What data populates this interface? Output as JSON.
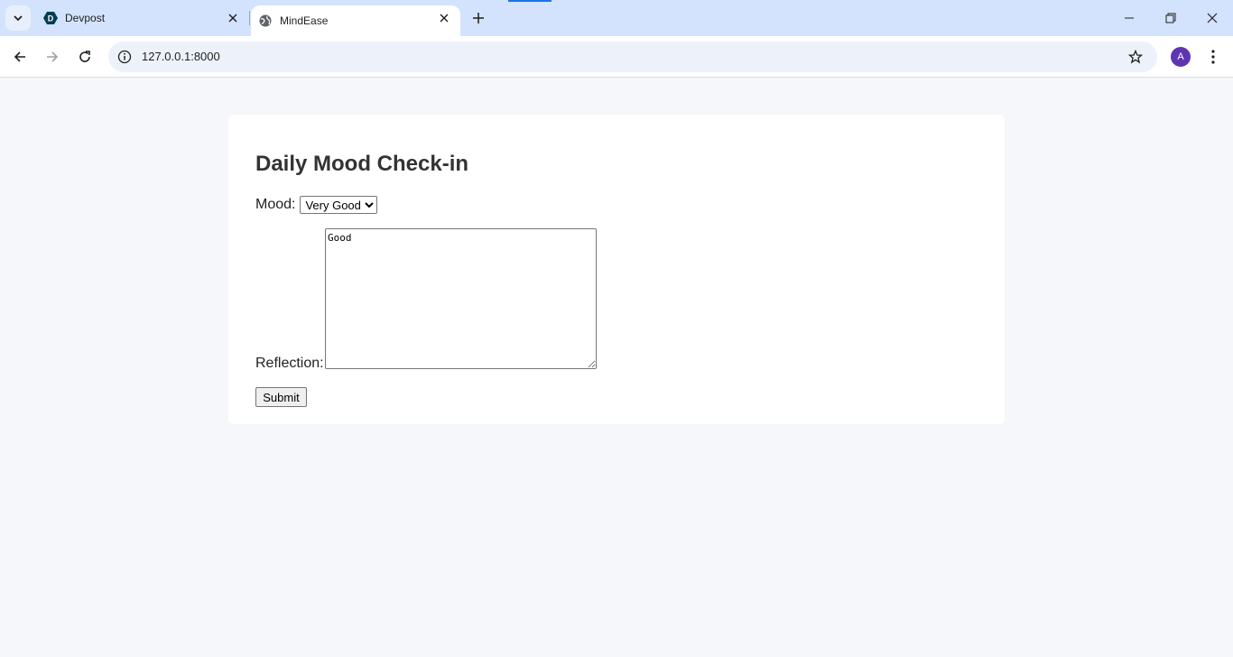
{
  "browser": {
    "tabs": [
      {
        "title": "Devpost",
        "active": false,
        "favicon": "devpost-logo-icon"
      },
      {
        "title": "MindEase",
        "active": true,
        "favicon": "globe-icon"
      }
    ],
    "url": "127.0.0.1:8000",
    "profile_initial": "A",
    "colors": {
      "tabbar": "#d3e3fd",
      "accent": "#1a73e8",
      "avatar": "#5e35b1"
    }
  },
  "page": {
    "title": "Daily Mood Check-in",
    "mood_label": "Mood:",
    "mood_selected": "Very Good",
    "reflection_label": "Reflection:",
    "reflection_value": "Good",
    "submit_label": "Submit"
  }
}
